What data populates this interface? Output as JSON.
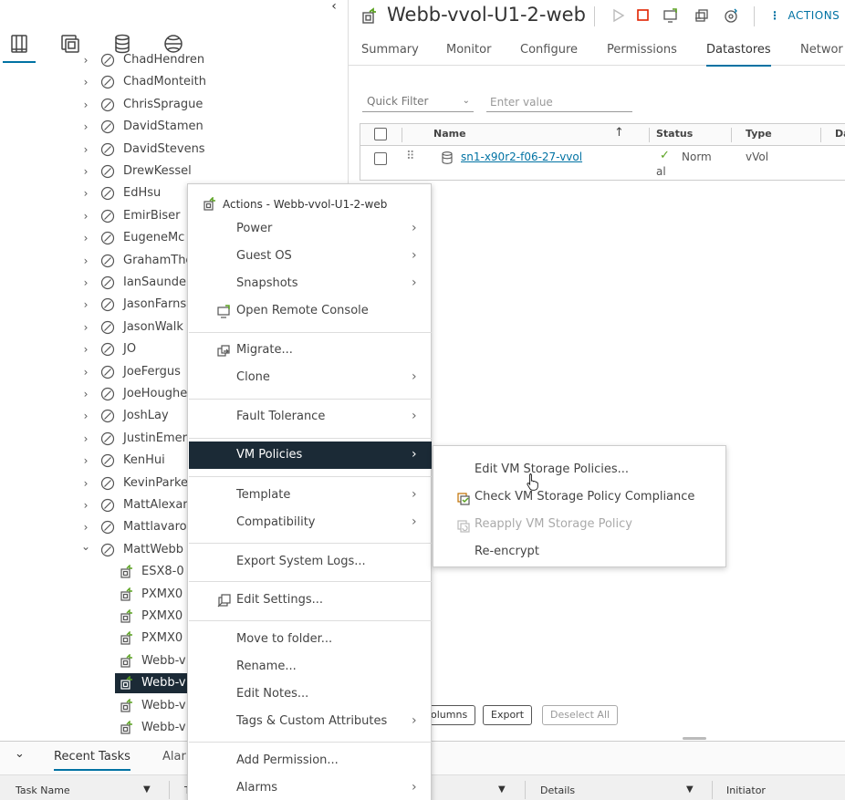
{
  "left_panel": {
    "collapse_glyph": "‹",
    "nav_icons": [
      "hosts-clusters-icon",
      "vms-templates-icon",
      "storage-icon",
      "networking-icon"
    ],
    "tree": [
      {
        "label": "ChadHendren",
        "kind": "folder",
        "expanded": false
      },
      {
        "label": "ChadMonteith",
        "kind": "folder",
        "expanded": false
      },
      {
        "label": "ChrisSprague",
        "kind": "folder",
        "expanded": false
      },
      {
        "label": "DavidStamen",
        "kind": "folder",
        "expanded": false
      },
      {
        "label": "DavidStevens",
        "kind": "folder",
        "expanded": false
      },
      {
        "label": "DrewKessel",
        "kind": "folder",
        "expanded": false
      },
      {
        "label": "EdHsu",
        "kind": "folder",
        "expanded": false
      },
      {
        "label": "EmirBiser",
        "kind": "folder",
        "expanded": false
      },
      {
        "label": "EugeneMc",
        "kind": "folder",
        "expanded": false
      },
      {
        "label": "GrahamThe",
        "kind": "folder",
        "expanded": false
      },
      {
        "label": "IanSaunder",
        "kind": "folder",
        "expanded": false
      },
      {
        "label": "JasonFarns",
        "kind": "folder",
        "expanded": false
      },
      {
        "label": "JasonWalk",
        "kind": "folder",
        "expanded": false
      },
      {
        "label": "JO",
        "kind": "folder",
        "expanded": false
      },
      {
        "label": "JoeFergus",
        "kind": "folder",
        "expanded": false
      },
      {
        "label": "JoeHoughe",
        "kind": "folder",
        "expanded": false
      },
      {
        "label": "JoshLay",
        "kind": "folder",
        "expanded": false
      },
      {
        "label": "JustinEmer",
        "kind": "folder",
        "expanded": false
      },
      {
        "label": "KenHui",
        "kind": "folder",
        "expanded": false
      },
      {
        "label": "KevinParke",
        "kind": "folder",
        "expanded": false
      },
      {
        "label": "MattAlexar",
        "kind": "folder",
        "expanded": false
      },
      {
        "label": "Mattlavaro",
        "kind": "folder",
        "expanded": false
      },
      {
        "label": "MattWebb",
        "kind": "folder",
        "expanded": true
      },
      {
        "label": "ESX8-0",
        "kind": "vm",
        "expanded": false
      },
      {
        "label": "PXMX0",
        "kind": "vm",
        "expanded": false
      },
      {
        "label": "PXMX0",
        "kind": "vm",
        "expanded": false
      },
      {
        "label": "PXMX0",
        "kind": "vm",
        "expanded": false
      },
      {
        "label": "Webb-v",
        "kind": "vm",
        "expanded": false
      },
      {
        "label": "Webb-v",
        "kind": "vm",
        "expanded": false,
        "selected": true
      },
      {
        "label": "Webb-v",
        "kind": "vm",
        "expanded": false
      },
      {
        "label": "Webb-v",
        "kind": "vm",
        "expanded": false
      }
    ]
  },
  "header": {
    "title": "Webb-vvol-U1-2-web",
    "actions_label": "ACTIONS",
    "toolbar_icons": [
      "power-on-icon",
      "power-off-icon",
      "launch-console-icon",
      "migrate-icon",
      "snapshot-icon"
    ]
  },
  "tabs": [
    {
      "label": "Summary",
      "active": false
    },
    {
      "label": "Monitor",
      "active": false
    },
    {
      "label": "Configure",
      "active": false
    },
    {
      "label": "Permissions",
      "active": false
    },
    {
      "label": "Datastores",
      "active": true
    },
    {
      "label": "Networ",
      "active": false
    }
  ],
  "filter": {
    "quick_filter_label": "Quick Filter",
    "value_placeholder": "Enter value"
  },
  "grid": {
    "columns": [
      "Name",
      "Status",
      "Type",
      "Da"
    ],
    "rows": [
      {
        "name": "sn1-x90r2-f06-27-vvol",
        "status_line1": "Norm",
        "status_line2": "al",
        "type": "vVol"
      }
    ],
    "footer_buttons": {
      "columns": "olumns",
      "export": "Export",
      "deselect_all": "Deselect All"
    }
  },
  "context_menu": {
    "title": "Actions - Webb-vvol-U1-2-web",
    "items": [
      {
        "label": "Power",
        "submenu": true
      },
      {
        "label": "Guest OS",
        "submenu": true
      },
      {
        "label": "Snapshots",
        "submenu": true
      },
      {
        "label": "Open Remote Console",
        "submenu": false
      },
      {
        "label": "Migrate...",
        "submenu": false
      },
      {
        "label": "Clone",
        "submenu": true
      },
      {
        "label": "Fault Tolerance",
        "submenu": true
      },
      {
        "label": "VM Policies",
        "submenu": true
      },
      {
        "label": "Template",
        "submenu": true
      },
      {
        "label": "Compatibility",
        "submenu": true
      },
      {
        "label": "Export System Logs...",
        "submenu": false
      },
      {
        "label": "Edit Settings...",
        "submenu": false
      },
      {
        "label": "Move to folder...",
        "submenu": false
      },
      {
        "label": "Rename...",
        "submenu": false
      },
      {
        "label": "Edit Notes...",
        "submenu": false
      },
      {
        "label": "Tags & Custom Attributes",
        "submenu": true
      },
      {
        "label": "Add Permission...",
        "submenu": false
      },
      {
        "label": "Alarms",
        "submenu": true
      }
    ]
  },
  "submenu": {
    "items": [
      {
        "label": "Edit VM Storage Policies...",
        "enabled": true
      },
      {
        "label": "Check VM Storage Policy Compliance",
        "enabled": true
      },
      {
        "label": "Reapply VM Storage Policy",
        "enabled": false
      },
      {
        "label": "Re-encrypt",
        "enabled": true
      }
    ]
  },
  "bottom_panel": {
    "tabs": [
      "Recent Tasks",
      "Alar"
    ],
    "columns": [
      "Task Name",
      "T",
      "Details",
      "Initiator"
    ]
  },
  "colors": {
    "accent": "#0072a3",
    "highlight": "#1b2a36",
    "ok_green": "#5aa220",
    "stop_red": "#e12200"
  }
}
